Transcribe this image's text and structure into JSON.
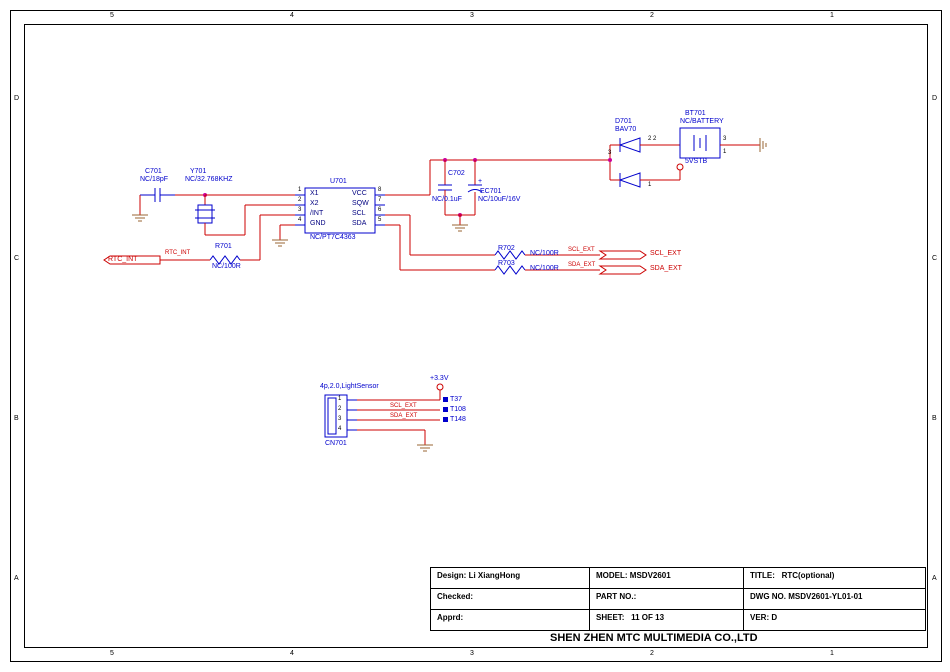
{
  "frame": {
    "ruler_top": [
      "5",
      "4",
      "3",
      "2",
      "1"
    ],
    "ruler_side": [
      "D",
      "C",
      "B",
      "A"
    ]
  },
  "title_block": {
    "design_label": "Design:",
    "design_value": "Li XiangHong",
    "checked_label": "Checked:",
    "apprd_label": "Apprd:",
    "model_label": "MODEL:",
    "model_value": "MSDV2601",
    "partno_label": "PART NO.:",
    "sheet_label": "SHEET:",
    "sheet_value": "11  OF  13",
    "title_label": "TITLE:",
    "title_value": "RTC(optional)",
    "dwg_label": "DWG NO.",
    "dwg_value": "MSDV2601-YL01-01",
    "ver_label": "VER:",
    "ver_value": "D",
    "company": "SHEN ZHEN MTC MULTIMEDIA CO.,LTD"
  },
  "components": {
    "C701": {
      "ref": "C701",
      "val": "NC/18pF"
    },
    "Y701": {
      "ref": "Y701",
      "val": "NC/32.768KHZ"
    },
    "U701": {
      "ref": "U701",
      "val": "NC/PT7C4363",
      "pins_left": [
        "X1",
        "X2",
        "/INT",
        "GND"
      ],
      "pins_right": [
        "VCC",
        "SQW",
        "SCL",
        "SDA"
      ],
      "nums_left": [
        "1",
        "2",
        "3",
        "4"
      ],
      "nums_right": [
        "8",
        "7",
        "6",
        "5"
      ]
    },
    "R701": {
      "ref": "R701",
      "val": "NC/100R"
    },
    "R702": {
      "ref": "R702",
      "val": "NC/100R"
    },
    "R703": {
      "ref": "R703",
      "val": "NC/100R"
    },
    "C702": {
      "ref": "C702",
      "val": "NC/0.1uF"
    },
    "EC701": {
      "ref": "EC701",
      "val": "NC/10uF/16V"
    },
    "D701": {
      "ref": "D701",
      "val": "BAV70"
    },
    "BT701": {
      "ref": "BT701",
      "val": "NC/BATTERY"
    },
    "CN701": {
      "ref": "CN701",
      "val": "4p,2.0,LightSensor",
      "pins": [
        "1",
        "2",
        "3",
        "4"
      ]
    }
  },
  "nets": {
    "RTC_INT": "RTC_INT",
    "SCL_EXT": "SCL_EXT",
    "SDA_EXT": "SDA_EXT",
    "5VSTB": "5VSTB",
    "3V3": "+3.3V"
  },
  "testpoints": {
    "T37": "T37",
    "T108": "T108",
    "T148": "T148"
  },
  "diode_pins": {
    "a1": "1",
    "a2": "2",
    "k": "3",
    "bt3": "3",
    "bt1": "1",
    "d22": "2  2"
  }
}
